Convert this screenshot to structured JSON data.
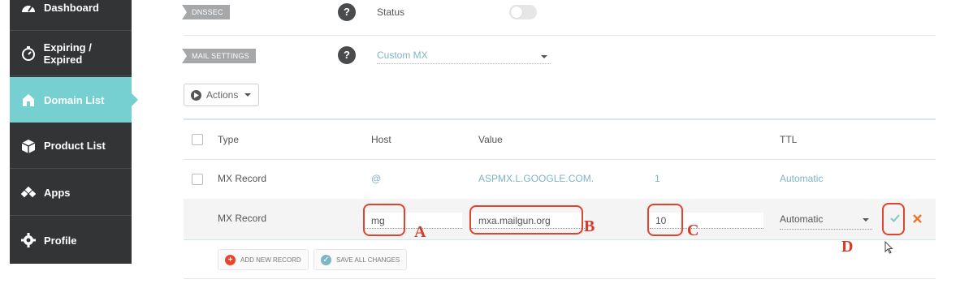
{
  "sidebar": {
    "items": [
      {
        "label": "Dashboard",
        "icon": "dashboard-icon"
      },
      {
        "label": "Expiring / Expired",
        "icon": "timer-icon"
      },
      {
        "label": "Domain List",
        "icon": "home-icon",
        "active": true
      },
      {
        "label": "Product List",
        "icon": "box-icon"
      },
      {
        "label": "Apps",
        "icon": "apps-icon"
      },
      {
        "label": "Profile",
        "icon": "gear-icon"
      }
    ]
  },
  "dnssec": {
    "tag": "DNSSEC",
    "help": "?",
    "status_label": "Status",
    "toggle_on": false
  },
  "mail": {
    "tag": "MAIL SETTINGS",
    "help": "?",
    "selected": "Custom MX"
  },
  "actions": {
    "label": "Actions"
  },
  "table": {
    "headers": {
      "type": "Type",
      "host": "Host",
      "value": "Value",
      "ttl": "TTL"
    },
    "row1": {
      "type": "MX Record",
      "host": "@",
      "value": "ASPMX.L.GOOGLE.COM.",
      "priority": "1",
      "ttl": "Automatic"
    },
    "edit": {
      "type": "MX Record",
      "host": "mg",
      "value": "mxa.mailgun.org",
      "priority": "10",
      "ttl": "Automatic"
    }
  },
  "buttons": {
    "add": "ADD NEW RECORD",
    "save": "SAVE ALL CHANGES"
  },
  "annotations": {
    "a": "A",
    "b": "B",
    "c": "C",
    "d": "D"
  },
  "colors": {
    "accent": "#76cfd0",
    "annotation": "#e0432f",
    "link": "#7fb4c4",
    "sidebar": "#333435"
  }
}
